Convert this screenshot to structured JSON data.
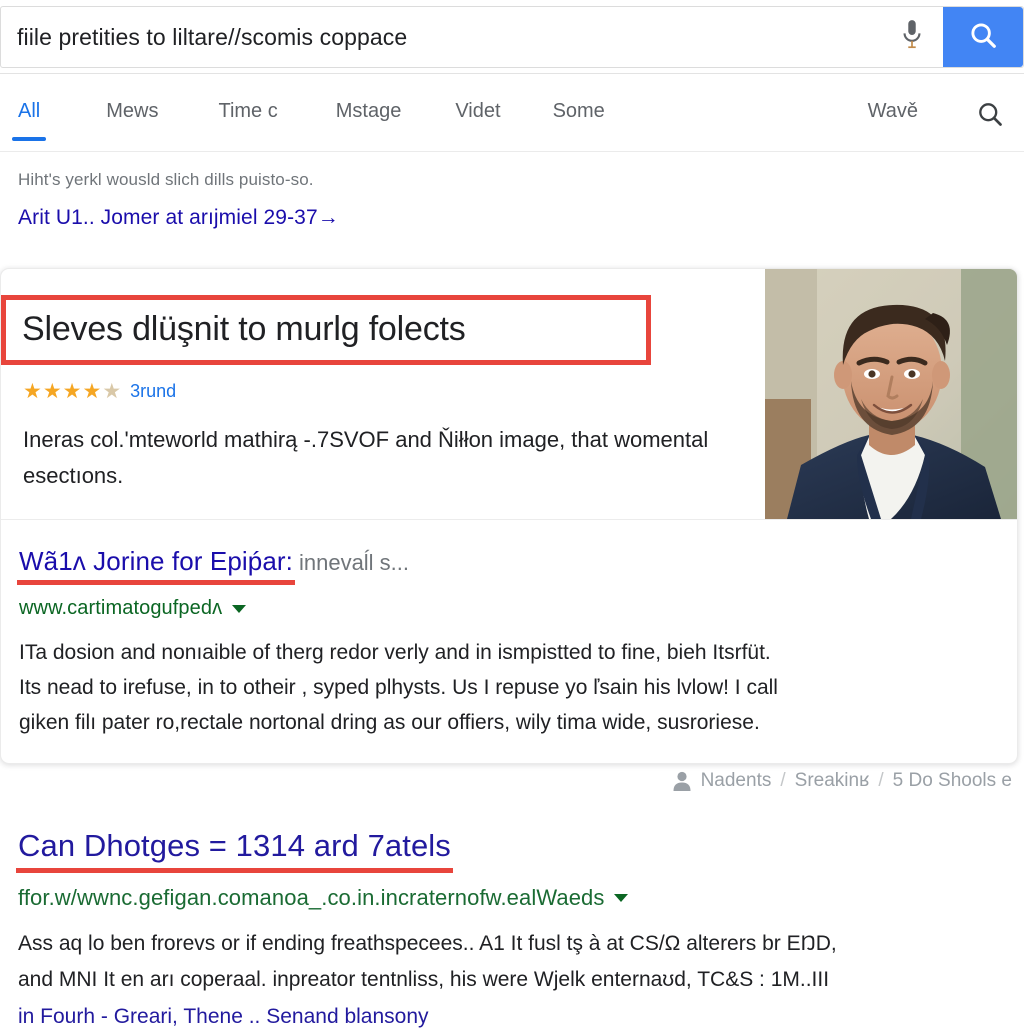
{
  "search": {
    "query": "fiile pretities to liltare//scomis coppace",
    "placeholder": "Search",
    "mic_icon": "microphone-icon",
    "submit_icon": "search-icon",
    "accent_color": "#4285f4"
  },
  "tabs": {
    "items": [
      {
        "label": "All",
        "active": true
      },
      {
        "label": "Mews",
        "active": false
      },
      {
        "label": "Time c",
        "active": false
      },
      {
        "label": "Mstage",
        "active": false
      },
      {
        "label": "Videt",
        "active": false
      },
      {
        "label": "Some",
        "active": false
      },
      {
        "label": "Wavě",
        "active": false
      }
    ],
    "tools_icon": "search-icon",
    "active_color": "#1a73e8"
  },
  "stats": {
    "did_you_mean": "Hiht's yerkl wousld slich dills puisto-so.",
    "spelling_suggestion": "Arit U1.. Jomer at arıjmiel 29-37→"
  },
  "featured_card": {
    "headline": "Sleves dlüşnit to murlg folects",
    "headline_box_color": "#e8453c",
    "rating": {
      "stars_filled": 4,
      "stars_half": 1,
      "stars_total": 5,
      "label": "3rund",
      "star_color": "#f5a623"
    },
    "description": "Ineras col.'mteworld mathirą -.7SVOF and Ňiłłon image, that womental esectıons.",
    "photo": {
      "alt": "portrait-photo-of-man-in-navy-blazer",
      "background_color": "#cfcab8",
      "jacket_color": "#22304b",
      "shirt_color": "#f2f2ee",
      "skin_color": "#d4a184",
      "hair_color": "#3b2a1e"
    },
    "result": {
      "title": "Wã1ʌ Jorine for Epiṕar:",
      "title_suffix": "innevaĺl s...",
      "url": "www.cartimatogufpedʌ",
      "caret_icon": "chevron-down-icon",
      "snippet_lines": [
        "ITa dosion and nonıaible of therg redor verly and in ismpistted to fine, bieh Itsrfüt.",
        "Its nead to irefuse, in to otheir , syped plhysts. Us I repuse yo ľsain his lvlow! I call",
        "giken filı pater ro,rectale nortonal dring as our offiers, wily tima wide, susroriese."
      ]
    }
  },
  "breadcrumb": {
    "person_icon": "person-icon",
    "items": [
      "Nadents",
      "Sreakinʁ",
      "5 Do Shools e"
    ],
    "separator": "/"
  },
  "result2": {
    "title": "Can Dhotges = 1314 ard 7atels",
    "underline_color": "#e8453c",
    "url": "ffor.w/wwnc.gefigan.comanoa_.co.in.incraternofw.ealWaeds",
    "caret_icon": "chevron-down-icon",
    "snippet_lines": [
      "Ass aq lo ben frorevs or if ending freathspecees.. A1 It fusl tş à at CS/Ω alterers br EŊD,",
      "and MNI It en arı coperaal. inpreator tentnliss, his were Wjelk enternaʊd, TC&S : 1M..III"
    ],
    "sitelinks": "in Fourh - Greari, Thene .. Senand blansony"
  }
}
